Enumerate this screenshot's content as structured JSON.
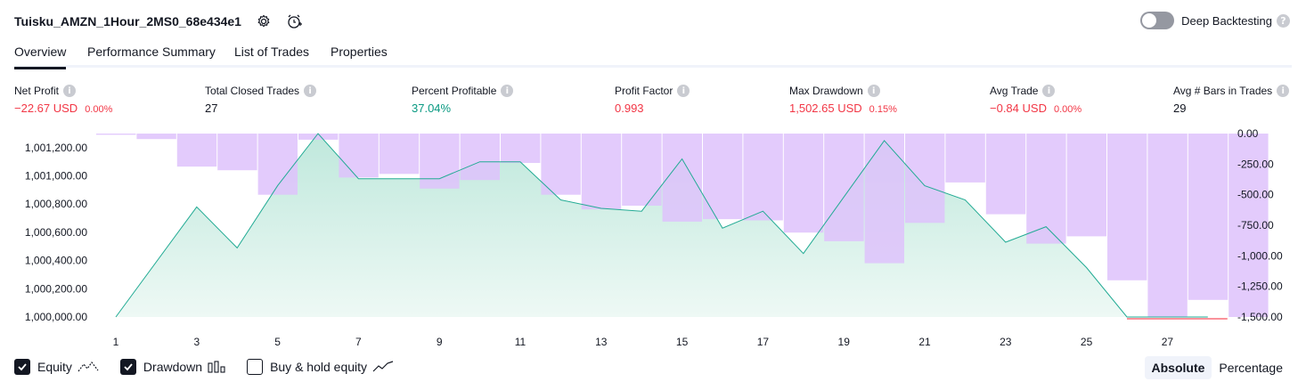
{
  "header": {
    "title": "Tuisku_AMZN_1Hour_2MS0_68e434e1",
    "deep_label": "Deep Backtesting"
  },
  "tabs": [
    {
      "label": "Overview"
    },
    {
      "label": "Performance Summary"
    },
    {
      "label": "List of Trades"
    },
    {
      "label": "Properties"
    }
  ],
  "metrics": [
    {
      "label": "Net Profit",
      "value": "−22.67 USD",
      "sub": "0.00%",
      "color": "#f23645"
    },
    {
      "label": "Total Closed Trades",
      "value": "27",
      "sub": "",
      "color": "#131722"
    },
    {
      "label": "Percent Profitable",
      "value": "37.04%",
      "sub": "",
      "color": "#089981"
    },
    {
      "label": "Profit Factor",
      "value": "0.993",
      "sub": "",
      "color": "#f23645"
    },
    {
      "label": "Max Drawdown",
      "value": "1,502.65 USD",
      "sub": "0.15%",
      "color": "#f23645"
    },
    {
      "label": "Avg Trade",
      "value": "−0.84 USD",
      "sub": "0.00%",
      "color": "#f23645"
    },
    {
      "label": "Avg # Bars in Trades",
      "value": "29",
      "sub": "",
      "color": "#131722"
    }
  ],
  "chart_data": {
    "type": "area",
    "x_ticks": [
      "1",
      "3",
      "5",
      "7",
      "9",
      "11",
      "13",
      "15",
      "17",
      "19",
      "21",
      "23",
      "25",
      "27"
    ],
    "x_range": [
      1,
      28
    ],
    "left_axis": {
      "ticks": [
        "1,001,200.00",
        "1,001,000.00",
        "1,000,800.00",
        "1,000,600.00",
        "1,000,400.00",
        "1,000,200.00",
        "1,000,000.00"
      ],
      "range": [
        1000000,
        1001300
      ]
    },
    "right_axis": {
      "ticks": [
        "0.00",
        "-250.00",
        "-500.00",
        "-750.00",
        "-1,000.00",
        "-1,250.00",
        "-1,500.00"
      ],
      "range": [
        -1500,
        0
      ]
    },
    "equity": {
      "name": "Equity",
      "x": [
        1,
        3,
        4,
        5,
        6,
        7,
        8,
        9,
        10,
        11,
        12,
        13,
        14,
        15,
        16,
        17,
        18,
        19,
        20,
        21,
        22,
        23,
        24,
        25,
        26,
        27,
        28
      ],
      "values": [
        1000000,
        1000780,
        1000490,
        1000930,
        1001300,
        1000980,
        1000980,
        1000980,
        1001100,
        1001100,
        1000830,
        1000770,
        1000750,
        1001120,
        1000630,
        1000750,
        1000450,
        1000850,
        1001250,
        1000930,
        1000830,
        1000530,
        1000640,
        1000350,
        1000000,
        1000000,
        1000000
      ]
    },
    "drawdown": {
      "name": "Drawdown",
      "values": [
        -10,
        -45,
        -270,
        -300,
        -500,
        -50,
        -360,
        -330,
        -450,
        -380,
        -240,
        -500,
        -620,
        -590,
        -720,
        -700,
        -710,
        -810,
        -880,
        -1060,
        -730,
        -400,
        -660,
        -900,
        -840,
        -1200,
        -1500,
        -1360,
        -1500
      ]
    },
    "equity_below_zero_segment": {
      "x": [
        26,
        28
      ],
      "value": 1000000
    },
    "legend": [
      "Equity",
      "Drawdown",
      "Buy & hold equity"
    ]
  },
  "legend": {
    "equity_label": "Equity",
    "drawdown_label": "Drawdown",
    "buyhold_label": "Buy & hold equity"
  },
  "mode": {
    "absolute": "Absolute",
    "percentage": "Percentage"
  },
  "colors": {
    "drawdown_bar": "#dec2fb",
    "equity_line": "#22ab94",
    "equity_fill": "#c8ece1",
    "negative_line": "#f7525f",
    "text": "#131722"
  }
}
